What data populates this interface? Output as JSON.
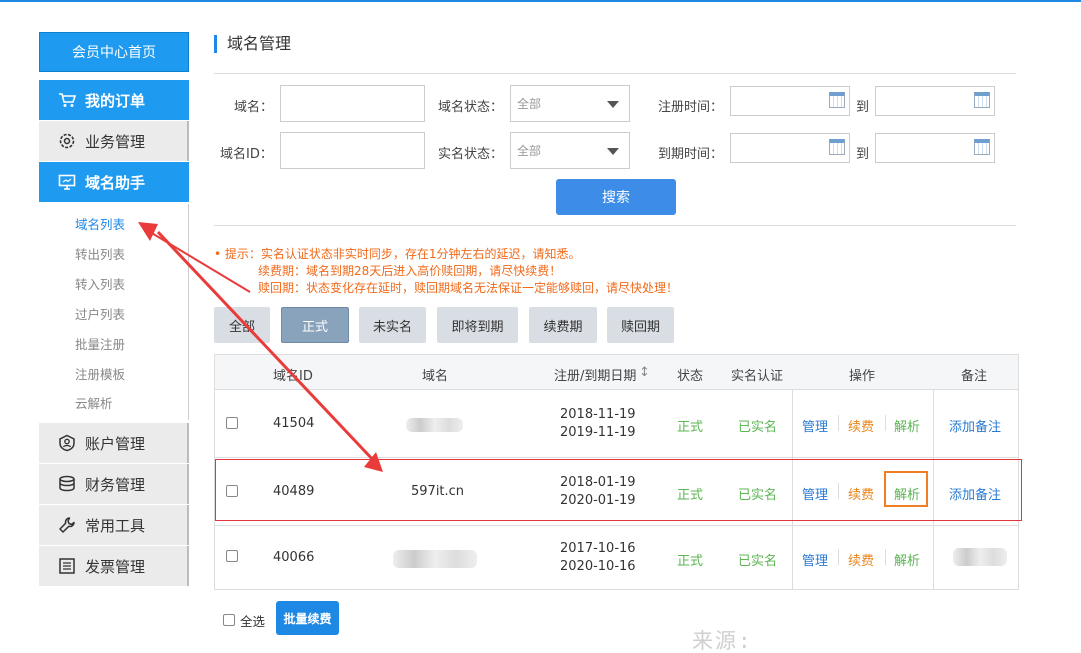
{
  "sidebar": {
    "home": "会员中心首页",
    "menu": [
      {
        "label": "我的订单",
        "icon": "cart-icon",
        "style": "active"
      },
      {
        "label": "业务管理",
        "icon": "gear-icon",
        "style": "gray"
      },
      {
        "label": "域名助手",
        "icon": "monitor-icon",
        "style": "active"
      }
    ],
    "submenu": [
      "域名列表",
      "转出列表",
      "转入列表",
      "过户列表",
      "批量注册",
      "注册模板",
      "云解析"
    ],
    "menu2": [
      {
        "label": "账户管理",
        "icon": "user-icon"
      },
      {
        "label": "财务管理",
        "icon": "coins-icon"
      },
      {
        "label": "常用工具",
        "icon": "wrench-icon"
      },
      {
        "label": "发票管理",
        "icon": "invoice-icon"
      }
    ]
  },
  "page": {
    "title": "域名管理"
  },
  "search": {
    "domain_label": "域名：",
    "domain_id_label": "域名ID：",
    "status_label": "域名状态：",
    "status_value": "全部",
    "realname_label": "实名状态：",
    "realname_value": "全部",
    "reg_time_label": "注册时间：",
    "exp_time_label": "到期时间：",
    "to": "到",
    "button": "搜索"
  },
  "notice": {
    "line1": "• 提示：实名认证状态非实时同步，存在1分钟左右的延迟，请知悉。",
    "line2": "续费期：域名到期28天后进入高价赎回期，请尽快续费！",
    "line3": "赎回期：状态变化存在延时，赎回期域名无法保证一定能够赎回，请尽快处理！"
  },
  "filters": [
    "全部",
    "正式",
    "未实名",
    "即将到期",
    "续费期",
    "赎回期"
  ],
  "filter_selected": "正式",
  "table": {
    "headers": {
      "id": "域名ID",
      "domain": "域名",
      "date": "注册/到期日期",
      "sort": "↕",
      "status": "状态",
      "realname": "实名认证",
      "ops": "操作",
      "note": "备注"
    },
    "rows": [
      {
        "id": "41504",
        "domain": "",
        "reg": "2018-11-19",
        "exp": "2019-11-19",
        "status": "正式",
        "realname": "已实名",
        "manage": "管理",
        "renew": "续费",
        "dns": "解析",
        "note": "添加备注"
      },
      {
        "id": "40489",
        "domain": "597it.cn",
        "reg": "2018-01-19",
        "exp": "2020-01-19",
        "status": "正式",
        "realname": "已实名",
        "manage": "管理",
        "renew": "续费",
        "dns": "解析",
        "note": "添加备注"
      },
      {
        "id": "40066",
        "domain": "",
        "reg": "2017-10-16",
        "exp": "2020-10-16",
        "status": "正式",
        "realname": "已实名",
        "manage": "管理",
        "renew": "续费",
        "dns": "解析",
        "note": ""
      }
    ]
  },
  "footer": {
    "select_all": "全选",
    "batch_renew": "批量续费"
  },
  "watermark": "来源: https://www.ahaoyw.com",
  "colors": {
    "accent": "#1e9af0",
    "notice": "#f06a1a",
    "ok": "#5bb552",
    "link": "#2a7ad2",
    "renew": "#e8861c",
    "highlight": "#e2343a"
  }
}
